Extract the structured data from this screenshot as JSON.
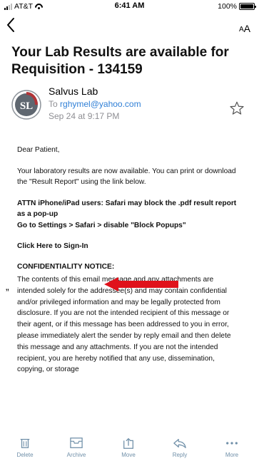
{
  "status_bar": {
    "carrier": "AT&T",
    "time": "6:41 AM",
    "battery": "100%"
  },
  "nav": {
    "back_icon": "chevron-left-icon",
    "text_size_icon": "text-size-icon"
  },
  "email": {
    "subject": "Your Lab Results are available for Requisition - 134159",
    "sender_name": "Salvus Lab",
    "to_prefix": "To",
    "to_address": "rghymel@yahoo.com",
    "date": "Sep 24 at 9:17 PM",
    "avatar_text": "SL",
    "body": {
      "greeting": "Dear Patient,",
      "paragraph1": "Your laboratory results are now available. You can print or download the \"Result Report\" using the link below.",
      "attn_line1": "ATTN iPhone/iPad users: Safari may block the .pdf result report as a pop-up",
      "attn_line2": "Go to Settings > Safari > disable \"Block Popups\"",
      "sign_in_link": "Click Here to Sign-In",
      "confidentiality_title": "CONFIDENTIALITY NOTICE:",
      "confidentiality_text": "The contents of this email message and any attachments are intended solely for the addressee(s) and may contain confidential and/or privileged information and may be legally protected from disclosure. If you are not the intended recipient of this message or their agent, or if this message has been addressed to you in error, please immediately alert the sender by reply email and then delete this message and any attachments. If you are not the intended recipient, you are hereby notified that any use, dissemination, copying, or storage"
    }
  },
  "annotation": {
    "stray_mark": "”",
    "arrow_color": "#e0121b"
  },
  "toolbar": {
    "items": [
      {
        "label": "Delete",
        "icon": "trash-icon"
      },
      {
        "label": "Archive",
        "icon": "archive-icon"
      },
      {
        "label": "Move",
        "icon": "move-icon"
      },
      {
        "label": "Reply",
        "icon": "reply-icon"
      },
      {
        "label": "More",
        "icon": "more-icon"
      }
    ]
  },
  "colors": {
    "link": "#2f7fd6",
    "meta_gray": "#8e8e93",
    "toolbar_icon": "#6f8fa8",
    "arrow_red": "#e0121b"
  }
}
